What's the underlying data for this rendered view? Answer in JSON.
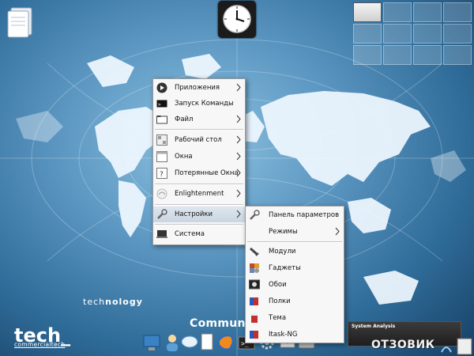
{
  "main_menu": {
    "items": [
      {
        "label": "Приложения",
        "icon": "play-icon",
        "submenu": true
      },
      {
        "label": "Запуск Команды",
        "icon": "terminal-icon",
        "submenu": false
      },
      {
        "label": "Файл",
        "icon": "folder-icon",
        "submenu": true
      },
      {
        "label": "Рабочий стол",
        "icon": "desktop-icon",
        "submenu": true
      },
      {
        "label": "Окна",
        "icon": "window-icon",
        "submenu": true
      },
      {
        "label": "Потерянные Окна",
        "icon": "lost-window-icon",
        "submenu": true
      },
      {
        "label": "Enlightenment",
        "icon": "enlightenment-icon",
        "submenu": true
      },
      {
        "label": "Настройки",
        "icon": "wrench-icon",
        "submenu": true
      },
      {
        "label": "Система",
        "icon": "computer-icon",
        "submenu": false
      }
    ]
  },
  "settings_menu": {
    "items": [
      {
        "label": "Панель параметров",
        "icon": "wrench-icon",
        "submenu": false
      },
      {
        "label": "Режимы",
        "icon": "",
        "submenu": true
      },
      {
        "label": "Модули",
        "icon": "plug-icon",
        "submenu": false
      },
      {
        "label": "Гаджеты",
        "icon": "gadgets-icon",
        "submenu": false
      },
      {
        "label": "Обои",
        "icon": "wallpaper-icon",
        "submenu": false
      },
      {
        "label": "Полки",
        "icon": "shelf-icon",
        "submenu": false
      },
      {
        "label": "Тема",
        "icon": "theme-icon",
        "submenu": false
      },
      {
        "label": "Itask-NG",
        "icon": "itask-icon",
        "submenu": false
      }
    ]
  },
  "desktop": {
    "logo_tagline_a": "tech",
    "logo_tagline_b": "nology",
    "logo_main": "tech_",
    "logo_sub": "commercialtech",
    "community": "Communi",
    "system_panel_title": "System Analysis",
    "watermark": "ОТЗОВИК"
  },
  "pager": {
    "rows": 3,
    "cols": 4,
    "active_index": 0
  },
  "colors": {
    "menu_bg": "#f7f7f7",
    "desktop_dark": "#163f63",
    "desktop_light": "#8fc3e0"
  }
}
